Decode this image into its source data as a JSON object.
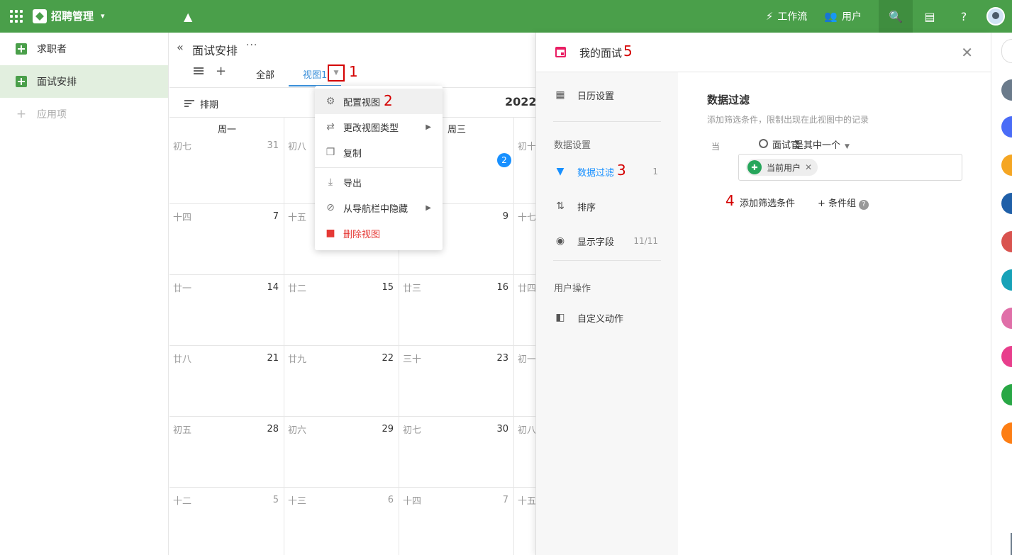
{
  "app": {
    "title": "招聘管理"
  },
  "topbar": {
    "workflow_label": "工作流",
    "users_label": "用户"
  },
  "sidebar": {
    "items": [
      {
        "label": "求职者"
      },
      {
        "label": "面试安排"
      }
    ],
    "add_label": "应用项"
  },
  "main": {
    "title": "面试安排",
    "more": "···",
    "tabs": [
      {
        "label": "全部"
      },
      {
        "label": "视图1"
      }
    ],
    "schedule_label": "排期",
    "current_period": "2022/"
  },
  "calendar": {
    "columns": [
      {
        "header": "周一",
        "cells": [
          {
            "lunar": "初七",
            "day": "31",
            "muted": true
          },
          {
            "lunar": "十四",
            "day": "7"
          },
          {
            "lunar": "廿一",
            "day": "14"
          },
          {
            "lunar": "廿八",
            "day": "21"
          },
          {
            "lunar": "初五",
            "day": "28"
          },
          {
            "lunar": "十二",
            "day": "5",
            "muted": true
          }
        ]
      },
      {
        "header": "",
        "cells": [
          {
            "lunar": "初八",
            "day": ""
          },
          {
            "lunar": "十五",
            "day": ""
          },
          {
            "lunar": "廿二",
            "day": "15"
          },
          {
            "lunar": "廿九",
            "day": "22"
          },
          {
            "lunar": "初六",
            "day": "29"
          },
          {
            "lunar": "十三",
            "day": "6",
            "muted": true
          }
        ]
      },
      {
        "header": "周三",
        "cells": [
          {
            "lunar": "",
            "day": "2",
            "today": true
          },
          {
            "lunar": "",
            "day": "9"
          },
          {
            "lunar": "廿三",
            "day": "16"
          },
          {
            "lunar": "三十",
            "day": "23"
          },
          {
            "lunar": "初七",
            "day": "30"
          },
          {
            "lunar": "十四",
            "day": "7",
            "muted": true
          }
        ]
      },
      {
        "header": "",
        "cells": [
          {
            "lunar": "初十",
            "day": ""
          },
          {
            "lunar": "十七",
            "day": ""
          },
          {
            "lunar": "廿四",
            "day": ""
          },
          {
            "lunar": "初一",
            "day": ""
          },
          {
            "lunar": "初八",
            "day": ""
          },
          {
            "lunar": "十五",
            "day": ""
          }
        ]
      }
    ]
  },
  "dropdown": {
    "items": [
      {
        "label": "配置视图",
        "icon": "gear-icon"
      },
      {
        "label": "更改视图类型",
        "icon": "swap-icon",
        "submenu": true
      },
      {
        "label": "复制",
        "icon": "copy-icon"
      },
      {
        "label": "导出",
        "icon": "download-icon"
      },
      {
        "label": "从导航栏中隐藏",
        "icon": "eye-off-icon",
        "submenu": true
      },
      {
        "label": "删除视图",
        "icon": "trash-icon",
        "danger": true
      }
    ]
  },
  "panel": {
    "title": "我的面试",
    "nav": {
      "calendar_settings": "日历设置",
      "data_section": "数据设置",
      "filter": "数据过滤",
      "filter_count": "1",
      "sort": "排序",
      "fields": "显示字段",
      "fields_count": "11/11",
      "user_section": "用户操作",
      "custom_action": "自定义动作"
    },
    "filter": {
      "title": "数据过滤",
      "description": "添加筛选条件，限制出现在此视图中的记录",
      "when": "当",
      "field": "面试官",
      "operator": "是其中一个",
      "value_chip": "当前用户",
      "add_condition": "添加筛选条件",
      "add_group": "条件组"
    }
  },
  "annotations": [
    "1",
    "2",
    "3",
    "4",
    "5"
  ],
  "colors": {
    "brand_green": "#4a9f4a",
    "accent_blue": "#1890ff",
    "danger_red": "#e53935",
    "annotation_red": "#d40000"
  }
}
